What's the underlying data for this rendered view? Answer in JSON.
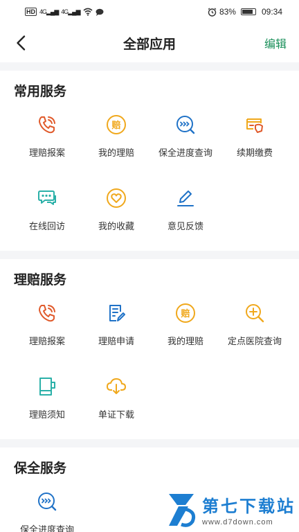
{
  "status_bar": {
    "hd": "HD",
    "signal1": "4G",
    "signal2": "4G",
    "battery_percent": "83%",
    "battery_level": 0.83,
    "time": "09:34",
    "icons": [
      "hd-icon",
      "signal-icon",
      "wifi-icon",
      "message-icon",
      "alarm-icon",
      "battery-icon"
    ]
  },
  "nav": {
    "title": "全部应用",
    "edit_label": "编辑",
    "back_icon": "chevron-left-icon"
  },
  "colors": {
    "accent_green": "#1a8f5a",
    "icon_orange_red": "#e05a2b",
    "icon_yellow": "#f0a81c",
    "icon_blue": "#1f72c7",
    "icon_teal": "#2ab0a8",
    "divider_gray": "#f4f5f7"
  },
  "sections": [
    {
      "title": "常用服务",
      "items": [
        {
          "label": "理赔报案",
          "icon": "phone-call-icon"
        },
        {
          "label": "我的理赔",
          "icon": "claim-coin-icon"
        },
        {
          "label": "保全进度查询",
          "icon": "progress-search-icon"
        },
        {
          "label": "续期缴费",
          "icon": "payment-card-icon"
        },
        {
          "label": "在线回访",
          "icon": "chat-bubble-icon"
        },
        {
          "label": "我的收藏",
          "icon": "heart-circle-icon"
        },
        {
          "label": "意见反馈",
          "icon": "pen-edit-icon"
        }
      ]
    },
    {
      "title": "理赔服务",
      "items": [
        {
          "label": "理赔报案",
          "icon": "phone-call-icon"
        },
        {
          "label": "理赔申请",
          "icon": "document-edit-icon"
        },
        {
          "label": "我的理赔",
          "icon": "claim-coin-icon"
        },
        {
          "label": "定点医院查询",
          "icon": "hospital-search-icon"
        },
        {
          "label": "理赔须知",
          "icon": "notice-book-icon"
        },
        {
          "label": "单证下载",
          "icon": "cloud-download-icon"
        }
      ]
    },
    {
      "title": "保全服务",
      "items": [
        {
          "label": "保全进度查询",
          "icon": "progress-search-icon"
        }
      ]
    }
  ],
  "watermark": {
    "name": "第七下载站",
    "url": "www.d7down.com"
  }
}
